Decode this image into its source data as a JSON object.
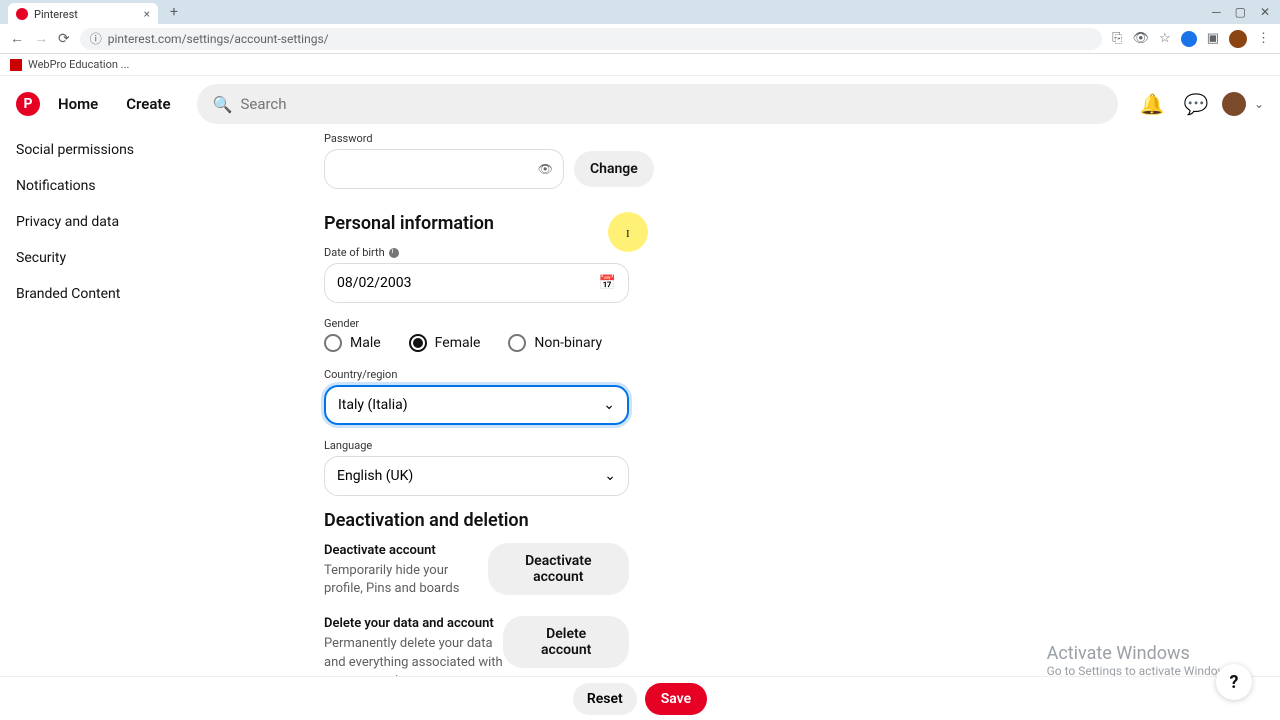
{
  "browser": {
    "tab_title": "Pinterest",
    "url": "pinterest.com/settings/account-settings/",
    "bookmark": "WebPro Education ..."
  },
  "header": {
    "home": "Home",
    "create": "Create",
    "search_placeholder": "Search"
  },
  "sidebar": {
    "items": [
      "Social permissions",
      "Notifications",
      "Privacy and data",
      "Security",
      "Branded Content"
    ]
  },
  "form": {
    "password_label": "Password",
    "change_btn": "Change",
    "section_personal": "Personal information",
    "dob_label": "Date of birth",
    "dob_value": "08/02/2003",
    "gender_label": "Gender",
    "gender_opts": {
      "male": "Male",
      "female": "Female",
      "nonbinary": "Non-binary"
    },
    "country_label": "Country/region",
    "country_value": "Italy (Italia)",
    "language_label": "Language",
    "language_value": "English (UK)",
    "section_deact": "Deactivation and deletion",
    "deact_h": "Deactivate account",
    "deact_desc": "Temporarily hide your profile, Pins and boards",
    "deact_btn": "Deactivate account",
    "delete_h": "Delete your data and account",
    "delete_desc": "Permanently delete your data and everything associated with your account",
    "delete_btn": "Delete account"
  },
  "footer": {
    "reset": "Reset",
    "save": "Save"
  },
  "watermark": {
    "heading": "Activate Windows",
    "sub": "Go to Settings to activate Windows."
  },
  "help": "?"
}
